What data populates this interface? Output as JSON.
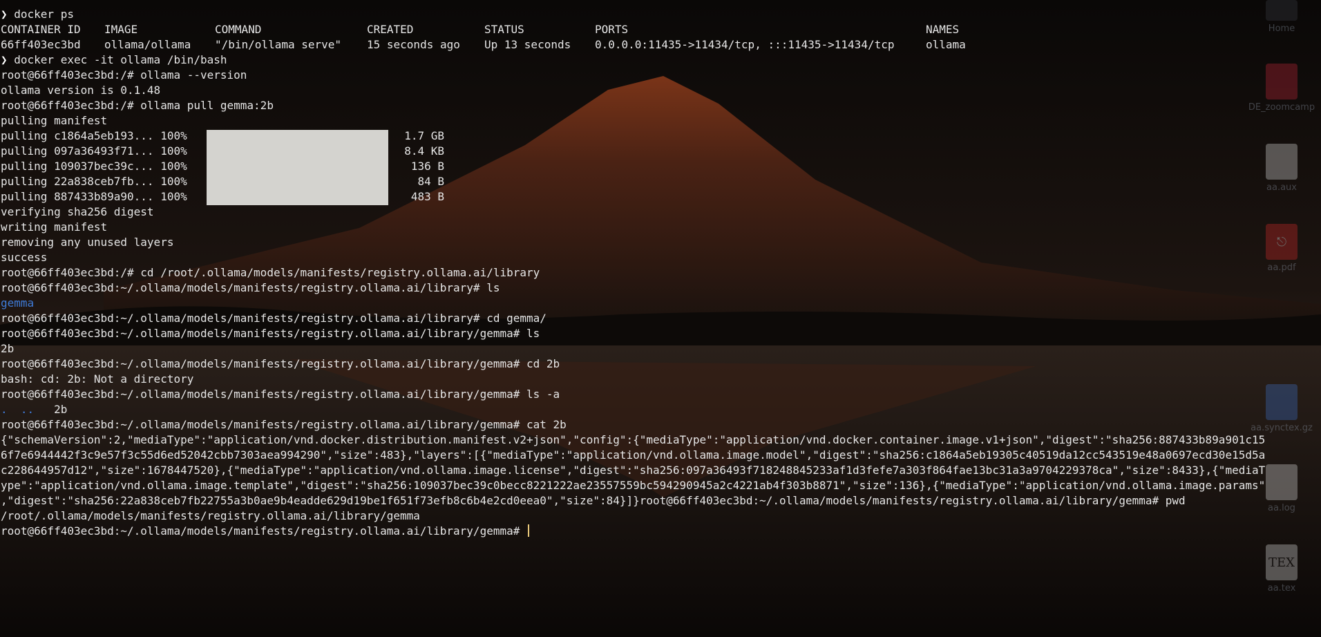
{
  "colors": {
    "terminal_text": "#e6e6e6",
    "directory": "#3f7bd8",
    "cursor": "#e8c87a",
    "progress_fill": "#d4d3cf",
    "background_sky": "#0b0807",
    "mountain_glow": "#6e2a16"
  },
  "terminal": {
    "lines": [
      {
        "prompt": "❯ ",
        "text": "docker ps"
      }
    ],
    "ps_header": [
      "CONTAINER ID",
      "IMAGE",
      "COMMAND",
      "CREATED",
      "STATUS",
      "PORTS",
      "NAMES"
    ],
    "ps_row": [
      "66ff403ec3bd",
      "ollama/ollama",
      "\"/bin/ollama serve\"",
      "15 seconds ago",
      "Up 13 seconds",
      "0.0.0.0:11435->11434/tcp, :::11435->11434/tcp",
      "ollama"
    ],
    "exec_cmd": {
      "prompt": "❯ ",
      "text": "docker exec -it ollama /bin/bash"
    },
    "version_cmd": "root@66ff403ec3bd:/# ollama --version",
    "version_out": "ollama version is 0.1.48",
    "pull_cmd": "root@66ff403ec3bd:/# ollama pull gemma:2b",
    "pulling_manifest": "pulling manifest",
    "pulls": [
      {
        "label": "pulling c1864a5eb193... 100%",
        "size": "1.7 GB",
        "progress": 1.0
      },
      {
        "label": "pulling 097a36493f71... 100%",
        "size": "8.4 KB",
        "progress": 1.0
      },
      {
        "label": "pulling 109037bec39c... 100%",
        "size": "136 B",
        "progress": 1.0
      },
      {
        "label": "pulling 22a838ceb7fb... 100%",
        "size": "84 B",
        "progress": 1.0
      },
      {
        "label": "pulling 887433b89a90... 100%",
        "size": "483 B",
        "progress": 1.0
      }
    ],
    "verifying": "verifying sha256 digest",
    "writing": "writing manifest",
    "removing": "removing any unused layers",
    "success": "success",
    "cd_library": "root@66ff403ec3bd:/# cd /root/.ollama/models/manifests/registry.ollama.ai/library",
    "ls1_cmd": "root@66ff403ec3bd:~/.ollama/models/manifests/registry.ollama.ai/library# ls",
    "ls1_out": "gemma",
    "cd_gemma": "root@66ff403ec3bd:~/.ollama/models/manifests/registry.ollama.ai/library# cd gemma/",
    "ls2_cmd": "root@66ff403ec3bd:~/.ollama/models/manifests/registry.ollama.ai/library/gemma# ls",
    "ls2_out": "2b",
    "cd_2b": "root@66ff403ec3bd:~/.ollama/models/manifests/registry.ollama.ai/library/gemma# cd 2b",
    "cd_2b_err": "bash: cd: 2b: Not a directory",
    "lsa_cmd": "root@66ff403ec3bd:~/.ollama/models/manifests/registry.ollama.ai/library/gemma# ls -a",
    "lsa_dots": ".  ..",
    "lsa_file": "2b",
    "cat_cmd": "root@66ff403ec3bd:~/.ollama/models/manifests/registry.ollama.ai/library/gemma# cat 2b",
    "json_lines": [
      "{\"schemaVersion\":2,\"mediaType\":\"application/vnd.docker.distribution.manifest.v2+json\",\"config\":{\"mediaType\":\"application/vnd.docker.container.image.v1+json\",\"digest\":\"sha256:887433b89a901c15",
      "6f7e6944442f3c9e57f3c55d6ed52042cbb7303aea994290\",\"size\":483},\"layers\":[{\"mediaType\":\"application/vnd.ollama.image.model\",\"digest\":\"sha256:c1864a5eb19305c40519da12cc543519e48a0697ecd30e15d5a",
      "c228644957d12\",\"size\":1678447520},{\"mediaType\":\"application/vnd.ollama.image.license\",\"digest\":\"sha256:097a36493f718248845233af1d3fefe7a303f864fae13bc31a3a9704229378ca\",\"size\":8433},{\"mediaT",
      "ype\":\"application/vnd.ollama.image.template\",\"digest\":\"sha256:109037bec39c0becc8221222ae23557559bc594290945a2c4221ab4f303b8871\",\"size\":136},{\"mediaType\":\"application/vnd.ollama.image.params\"",
      ",\"digest\":\"sha256:22a838ceb7fb22755a3b0ae9b4eadde629d19be1f651f73efb8c6b4e2cd0eea0\",\"size\":84}]}root@66ff403ec3bd:~/.ollama/models/manifests/registry.ollama.ai/library/gemma# pwd"
    ],
    "pwd_out": "/root/.ollama/models/manifests/registry.ollama.ai/library/gemma",
    "final_prompt": "root@66ff403ec3bd:~/.ollama/models/manifests/registry.ollama.ai/library/gemma# "
  },
  "desktop": {
    "icons": [
      {
        "name": "Home",
        "icon": "home-folder-icon"
      },
      {
        "name": "DE_zoomcamp",
        "icon": "folder-icon"
      },
      {
        "name": "aa.aux",
        "icon": "text-document-icon"
      },
      {
        "name": "aa.pdf",
        "icon": "pdf-icon"
      },
      {
        "name": "aa.synctex.gz",
        "icon": "archive-icon"
      },
      {
        "name": "aa.log",
        "icon": "text-document-icon"
      },
      {
        "name": "aa.tex",
        "icon": "tex-document-icon"
      }
    ]
  }
}
